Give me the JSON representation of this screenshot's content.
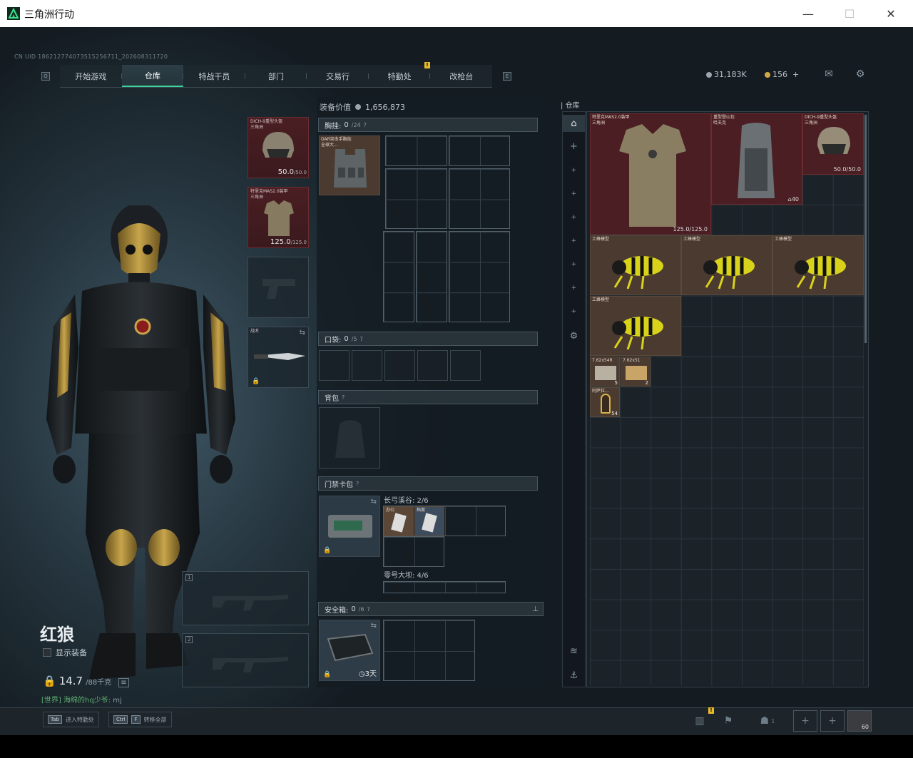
{
  "window": {
    "title": "三角洲行动",
    "minimize": "—",
    "maximize": "☐",
    "close": "✕"
  },
  "uid": "CN UID 1862127740735152​56711_202608311720",
  "nav": {
    "q_key": "Q",
    "e_key": "E",
    "tabs": [
      "开始游戏",
      "仓库",
      "特战干员",
      "部门",
      "交易行",
      "特勤处",
      "改枪台"
    ],
    "active": "仓库",
    "alert_badge": "!"
  },
  "currency": {
    "coupons": "31,183K",
    "premium": "156",
    "plus": "+"
  },
  "operator": {
    "name": "红狼",
    "show_equipment": "显示装备",
    "weight": "14.7",
    "weight_max": "/88千克"
  },
  "chat": {
    "channel": "[世界]",
    "sender": "海绵的hq少爷:",
    "text": "mj"
  },
  "left_slots": {
    "helmet": {
      "name": "DICH-9重型头盔\n三角洲",
      "durability": "50.0",
      "durability_max": "/50.0"
    },
    "armor": {
      "name": "特里克MAS2.0装甲\n三角洲",
      "durability": "125.0",
      "durability_max": "/125.0"
    },
    "melee_label": "战术"
  },
  "loadout": {
    "value_label": "装备价值",
    "value": "1,656,873",
    "chest_rig": {
      "label": "胸挂:",
      "count": "0",
      "capacity": "/24",
      "item_name": "DAR突击手胸挂\n全球大..."
    },
    "pockets": {
      "label": "口袋:",
      "count": "0",
      "capacity": "/5"
    },
    "backpack": {
      "label": "背包"
    },
    "keycard": {
      "label": "门禁卡包",
      "zone1": "长弓溪谷: 2/6",
      "zone2": "零号大坝: 4/6",
      "card1": "办公",
      "card2": "档案"
    },
    "safe_box": {
      "label": "安全箱:",
      "count": "0",
      "capacity": "/6",
      "timer": "3天"
    }
  },
  "storage": {
    "label": "仓库",
    "items": [
      {
        "name": "特里克MAS2.0装甲\n三角洲",
        "dur": "125.0/125.0"
      },
      {
        "name": "重型登山包\n哈夫克",
        "count": "40"
      },
      {
        "name": "DICH-9重型头盔\n三角洲",
        "dur": "50.0/50.0"
      },
      {
        "name": "工蜂模型"
      },
      {
        "name": "工蜂模型"
      },
      {
        "name": "工蜂模型"
      },
      {
        "name": "工蜂模型"
      },
      {
        "name": "7.62x54R",
        "count": "5"
      },
      {
        "name": "7.62x51",
        "count": "2"
      },
      {
        "name": "阿萨拉...",
        "count": "54"
      }
    ]
  },
  "bottom": {
    "tab_key": "Tab",
    "tab_text": "进入特勤处",
    "ctrl_key": "Ctrl",
    "f_key": "F",
    "ctrl_text": "转移全部",
    "squad_count": "1",
    "avatar_level": "60"
  }
}
